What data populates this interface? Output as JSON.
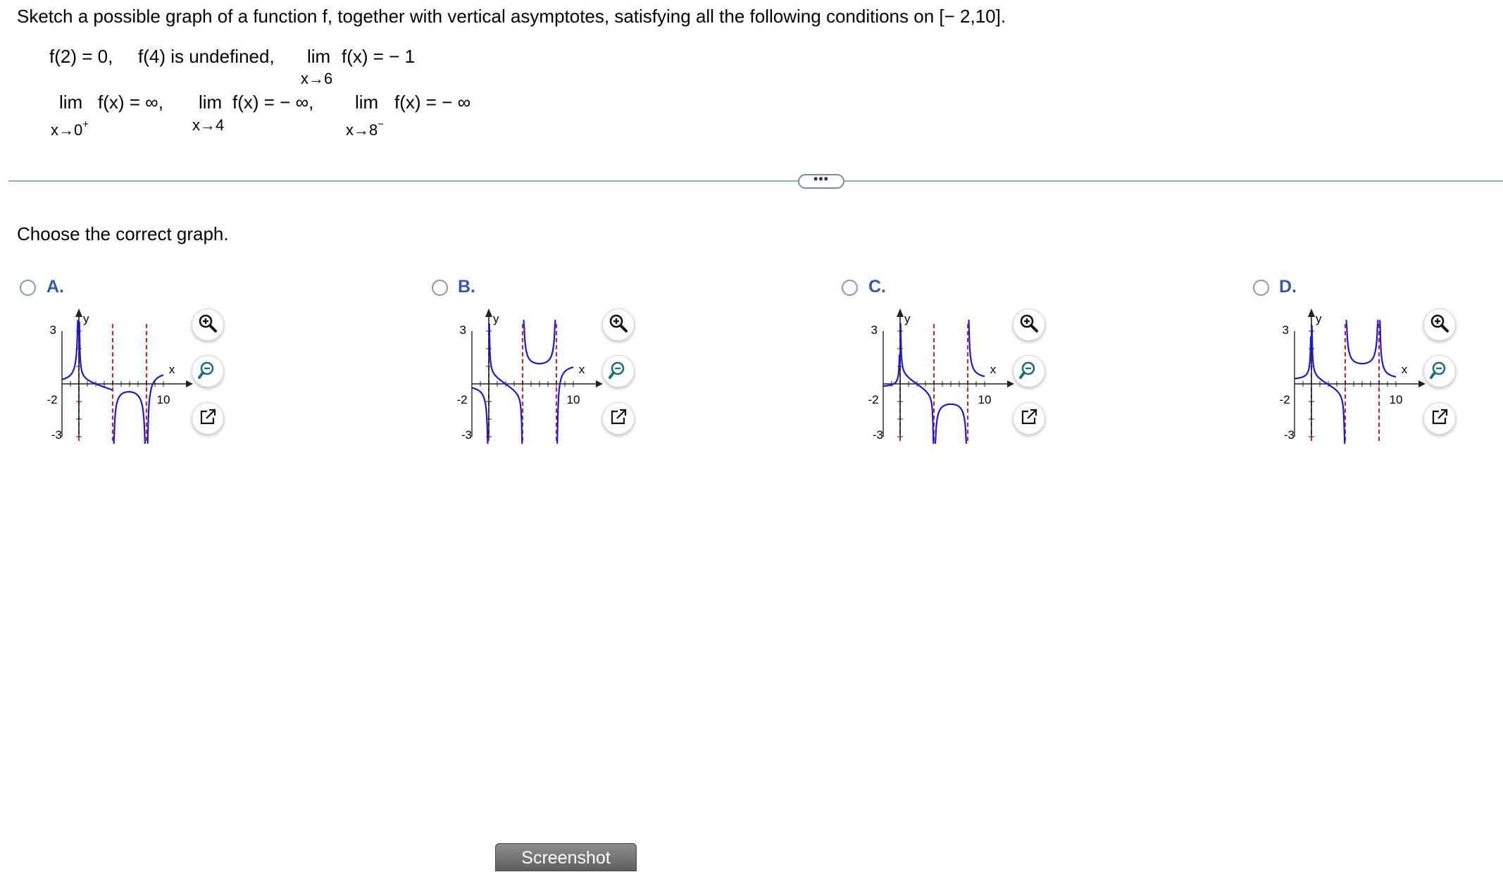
{
  "question": {
    "prompt": "Sketch a possible graph of a function f, together with vertical asymptotes, satisfying all the following conditions on [− 2,10].",
    "cond1": "f(2) = 0,",
    "cond2": "f(4) is undefined,",
    "cond3_lim": "lim",
    "cond3_expr": "f(x) = − 1",
    "cond3_sub": "x→6",
    "cond4_lim": "lim",
    "cond4_expr": "f(x) = ∞,",
    "cond4_sub": "x→0",
    "cond4_sup": "+",
    "cond5_lim": "lim",
    "cond5_expr": "f(x) = − ∞,",
    "cond5_sub": "x→4",
    "cond6_lim": "lim",
    "cond6_expr": "f(x) = − ∞",
    "cond6_sub": "x→8",
    "cond6_sup": "−"
  },
  "more_button": "•••",
  "instruction": "Choose the correct graph.",
  "options": [
    {
      "letter": "A.",
      "tick_y_top": "3",
      "tick_x_left": "-2",
      "tick_y_bottom": "-3",
      "tick_x_right": "10",
      "x_axis_label": "x",
      "y_axis_label": "y"
    },
    {
      "letter": "B.",
      "tick_y_top": "3",
      "tick_x_left": "-2",
      "tick_y_bottom": "-3",
      "tick_x_right": "10",
      "x_axis_label": "x",
      "y_axis_label": "y"
    },
    {
      "letter": "C.",
      "tick_y_top": "3",
      "tick_x_left": "-2",
      "tick_y_bottom": "-3",
      "tick_x_right": "10",
      "x_axis_label": "x",
      "y_axis_label": "y"
    },
    {
      "letter": "D.",
      "tick_y_top": "3",
      "tick_x_left": "-2",
      "tick_y_bottom": "-3",
      "tick_x_right": "10",
      "x_axis_label": "x",
      "y_axis_label": "y"
    }
  ],
  "icons": {
    "zoom_in": "zoom-in-icon",
    "zoom_out": "zoom-out-icon",
    "popout": "popout-icon"
  },
  "colors": {
    "curve": "#1a1ad6",
    "asymptote": "#e02020",
    "option_label": "#3457b2"
  },
  "screenshot_button": "Screenshot"
}
